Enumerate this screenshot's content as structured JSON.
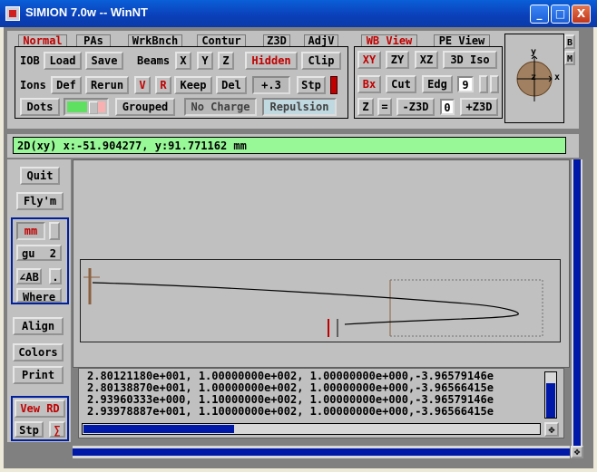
{
  "window": {
    "title": "SIMION 7.0w -- WinNT"
  },
  "controls": {
    "minimize": "_",
    "maximize": "□",
    "close": "X"
  },
  "tabs": [
    "Normal",
    "PAs",
    "WrkBnch",
    "Contur",
    "Z3D",
    "AdjV"
  ],
  "view_tabs": [
    "WB View",
    "PE View"
  ],
  "toolbar": {
    "iob": "IOB",
    "load": "Load",
    "save": "Save",
    "beams": "Beams",
    "x": "X",
    "y": "Y",
    "z": "Z",
    "hidden": "Hidden",
    "clip": "Clip",
    "ions": "Ions",
    "def": "Def",
    "rerun": "Rerun",
    "v": "V",
    "r": "R",
    "keep": "Keep",
    "del": "Del",
    "step_value": "+.3",
    "stp": "Stp",
    "dots": "Dots",
    "grouped": "Grouped",
    "no_charge": "No Charge",
    "repulsion": "Repulsion"
  },
  "view": {
    "xy": "XY",
    "zy": "ZY",
    "xz": "XZ",
    "iso": "3D Iso",
    "bx": "Bx",
    "cut": "Cut",
    "edg": "Edg",
    "nine": "9",
    "z": "Z",
    "eq": "=",
    "minus_z3d": "-Z3D",
    "zero": "0",
    "plus_z3d": "+Z3D"
  },
  "side_buttons": {
    "b": "B",
    "m": "M"
  },
  "compass": {
    "y": "y",
    "z": "z",
    "x": "x"
  },
  "coord_readout": "2D(xy) x:-51.904277, y:91.771162 mm",
  "left": {
    "quit": "Quit",
    "flym": "Fly'm",
    "mm": "mm",
    "gu_label": "gu",
    "gu_value": "2",
    "ab": "∠AB",
    "dot": ".",
    "where": "Where",
    "align": "Align",
    "colors": "Colors",
    "print": "Print",
    "view_rd": "Vew RD",
    "stp": "Stp",
    "sigma": "∑"
  },
  "data_lines": [
    "2.80121180e+001, 1.00000000e+002, 1.00000000e+000,-3.96579146e",
    "2.80138870e+001, 1.00000000e+002, 1.00000000e+000,-3.96566415e",
    "2.93960333e+000, 1.10000000e+002, 1.00000000e+000,-3.96579146e",
    "2.93978887e+001, 1.10000000e+002, 1.00000000e+000,-3.96566415e"
  ],
  "data_scroll_fraction": 0.33,
  "colors": {
    "accent_green": "#98f898",
    "scroll_blue": "#0018a8",
    "trajectory_red": "#c00000"
  }
}
